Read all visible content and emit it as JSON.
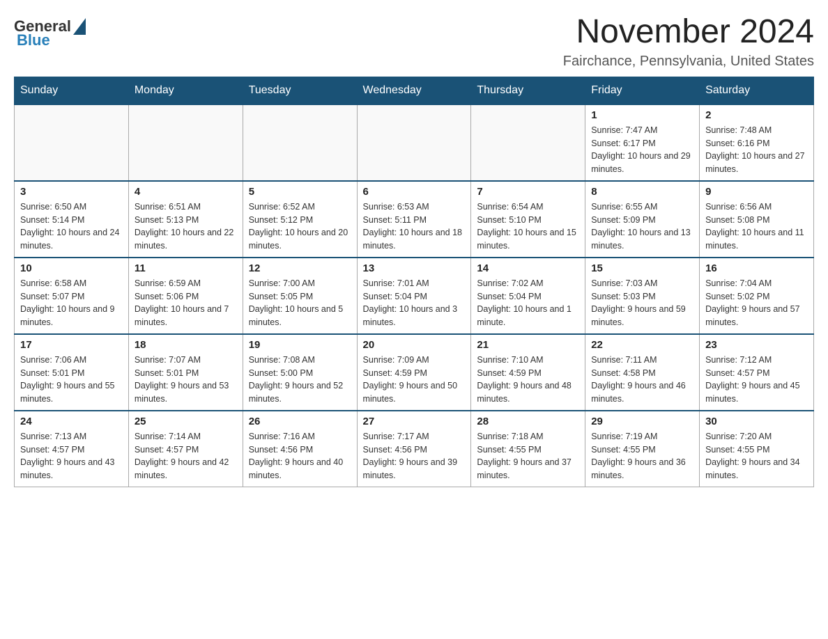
{
  "header": {
    "logo_general": "General",
    "logo_blue": "Blue",
    "month": "November 2024",
    "location": "Fairchance, Pennsylvania, United States"
  },
  "days_of_week": [
    "Sunday",
    "Monday",
    "Tuesday",
    "Wednesday",
    "Thursday",
    "Friday",
    "Saturday"
  ],
  "weeks": [
    [
      {
        "day": "",
        "info": ""
      },
      {
        "day": "",
        "info": ""
      },
      {
        "day": "",
        "info": ""
      },
      {
        "day": "",
        "info": ""
      },
      {
        "day": "",
        "info": ""
      },
      {
        "day": "1",
        "info": "Sunrise: 7:47 AM\nSunset: 6:17 PM\nDaylight: 10 hours and 29 minutes."
      },
      {
        "day": "2",
        "info": "Sunrise: 7:48 AM\nSunset: 6:16 PM\nDaylight: 10 hours and 27 minutes."
      }
    ],
    [
      {
        "day": "3",
        "info": "Sunrise: 6:50 AM\nSunset: 5:14 PM\nDaylight: 10 hours and 24 minutes."
      },
      {
        "day": "4",
        "info": "Sunrise: 6:51 AM\nSunset: 5:13 PM\nDaylight: 10 hours and 22 minutes."
      },
      {
        "day": "5",
        "info": "Sunrise: 6:52 AM\nSunset: 5:12 PM\nDaylight: 10 hours and 20 minutes."
      },
      {
        "day": "6",
        "info": "Sunrise: 6:53 AM\nSunset: 5:11 PM\nDaylight: 10 hours and 18 minutes."
      },
      {
        "day": "7",
        "info": "Sunrise: 6:54 AM\nSunset: 5:10 PM\nDaylight: 10 hours and 15 minutes."
      },
      {
        "day": "8",
        "info": "Sunrise: 6:55 AM\nSunset: 5:09 PM\nDaylight: 10 hours and 13 minutes."
      },
      {
        "day": "9",
        "info": "Sunrise: 6:56 AM\nSunset: 5:08 PM\nDaylight: 10 hours and 11 minutes."
      }
    ],
    [
      {
        "day": "10",
        "info": "Sunrise: 6:58 AM\nSunset: 5:07 PM\nDaylight: 10 hours and 9 minutes."
      },
      {
        "day": "11",
        "info": "Sunrise: 6:59 AM\nSunset: 5:06 PM\nDaylight: 10 hours and 7 minutes."
      },
      {
        "day": "12",
        "info": "Sunrise: 7:00 AM\nSunset: 5:05 PM\nDaylight: 10 hours and 5 minutes."
      },
      {
        "day": "13",
        "info": "Sunrise: 7:01 AM\nSunset: 5:04 PM\nDaylight: 10 hours and 3 minutes."
      },
      {
        "day": "14",
        "info": "Sunrise: 7:02 AM\nSunset: 5:04 PM\nDaylight: 10 hours and 1 minute."
      },
      {
        "day": "15",
        "info": "Sunrise: 7:03 AM\nSunset: 5:03 PM\nDaylight: 9 hours and 59 minutes."
      },
      {
        "day": "16",
        "info": "Sunrise: 7:04 AM\nSunset: 5:02 PM\nDaylight: 9 hours and 57 minutes."
      }
    ],
    [
      {
        "day": "17",
        "info": "Sunrise: 7:06 AM\nSunset: 5:01 PM\nDaylight: 9 hours and 55 minutes."
      },
      {
        "day": "18",
        "info": "Sunrise: 7:07 AM\nSunset: 5:01 PM\nDaylight: 9 hours and 53 minutes."
      },
      {
        "day": "19",
        "info": "Sunrise: 7:08 AM\nSunset: 5:00 PM\nDaylight: 9 hours and 52 minutes."
      },
      {
        "day": "20",
        "info": "Sunrise: 7:09 AM\nSunset: 4:59 PM\nDaylight: 9 hours and 50 minutes."
      },
      {
        "day": "21",
        "info": "Sunrise: 7:10 AM\nSunset: 4:59 PM\nDaylight: 9 hours and 48 minutes."
      },
      {
        "day": "22",
        "info": "Sunrise: 7:11 AM\nSunset: 4:58 PM\nDaylight: 9 hours and 46 minutes."
      },
      {
        "day": "23",
        "info": "Sunrise: 7:12 AM\nSunset: 4:57 PM\nDaylight: 9 hours and 45 minutes."
      }
    ],
    [
      {
        "day": "24",
        "info": "Sunrise: 7:13 AM\nSunset: 4:57 PM\nDaylight: 9 hours and 43 minutes."
      },
      {
        "day": "25",
        "info": "Sunrise: 7:14 AM\nSunset: 4:57 PM\nDaylight: 9 hours and 42 minutes."
      },
      {
        "day": "26",
        "info": "Sunrise: 7:16 AM\nSunset: 4:56 PM\nDaylight: 9 hours and 40 minutes."
      },
      {
        "day": "27",
        "info": "Sunrise: 7:17 AM\nSunset: 4:56 PM\nDaylight: 9 hours and 39 minutes."
      },
      {
        "day": "28",
        "info": "Sunrise: 7:18 AM\nSunset: 4:55 PM\nDaylight: 9 hours and 37 minutes."
      },
      {
        "day": "29",
        "info": "Sunrise: 7:19 AM\nSunset: 4:55 PM\nDaylight: 9 hours and 36 minutes."
      },
      {
        "day": "30",
        "info": "Sunrise: 7:20 AM\nSunset: 4:55 PM\nDaylight: 9 hours and 34 minutes."
      }
    ]
  ]
}
